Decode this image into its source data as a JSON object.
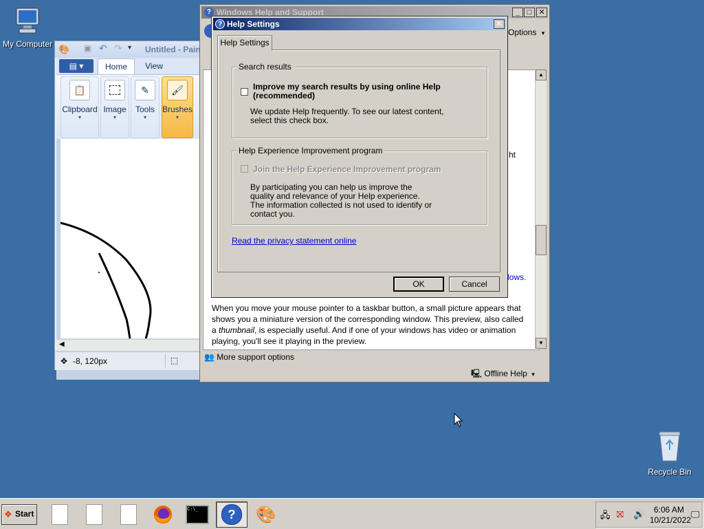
{
  "desktop": {
    "icons": [
      {
        "label": "My Computer"
      },
      {
        "label": "Recycle Bin"
      }
    ]
  },
  "paint": {
    "title": "Untitled - Paint",
    "menu_button": "▾",
    "tabs": [
      "Home",
      "View"
    ],
    "groups": [
      "Clipboard",
      "Image",
      "Tools",
      "Brushes"
    ],
    "status_position": "-8, 120px"
  },
  "help_window": {
    "title": "Windows Help and Support",
    "options_label": "Options",
    "partial_text_1": "ht",
    "partial_text_2": "dows.",
    "paragraph_parts": {
      "before": "When you move your mouse pointer to a taskbar button, a small picture appears that shows you a miniature version of the corresponding window. This preview, also called a ",
      "emph": "thumbnail",
      "after": ", is especially useful. And if one of your windows has video or animation playing, you'll see it playing in the preview."
    },
    "more_support": "More support options",
    "offline_help": "Offline Help"
  },
  "dialog": {
    "title": "Help Settings",
    "tab": "Help Settings",
    "group1": {
      "legend": "Search results",
      "checkbox_label": "Improve my search results by using online Help (recommended)",
      "checked": false,
      "description": "We update Help frequently. To see our latest content, select this check box."
    },
    "group2": {
      "legend": "Help Experience Improvement program",
      "checkbox_label": "Join the Help Experience Improvement program",
      "enabled": false,
      "description": "By participating you can help us improve the quality and relevance of your Help experience. The information collected is not used to identify or contact you."
    },
    "privacy_link": "Read the privacy statement online",
    "ok": "OK",
    "cancel": "Cancel"
  },
  "taskbar": {
    "start": "Start",
    "time": "6:06 AM",
    "date": "10/21/2022"
  },
  "colors": {
    "desktop": "#3a6ea5",
    "title_active": "#0a246a",
    "link": "#0000cc"
  }
}
